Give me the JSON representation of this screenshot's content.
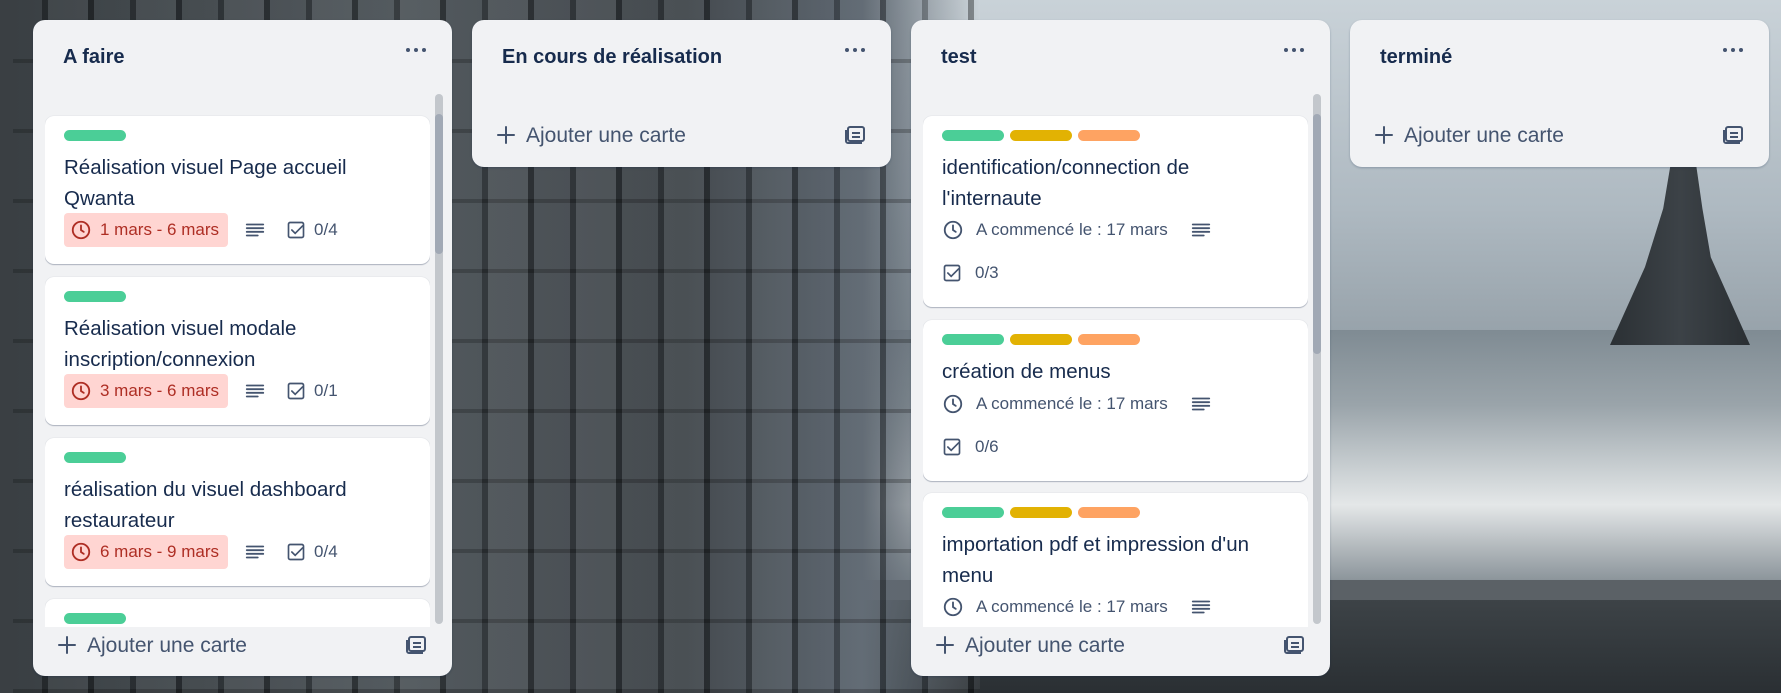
{
  "board": {
    "lists": [
      {
        "title": "A faire",
        "add_card_label": "Ajouter une carte",
        "cards": [
          {
            "labels": [
              "#4bce97"
            ],
            "title": "Réalisation visuel Page accueil Qwanta",
            "due": "1 mars - 6 mars",
            "checklist": "0/4"
          },
          {
            "labels": [
              "#4bce97"
            ],
            "title": "Réalisation visuel modale inscription/connexion",
            "due": "3 mars - 6 mars",
            "checklist": "0/1"
          },
          {
            "labels": [
              "#4bce97"
            ],
            "title": "réalisation du visuel dashboard restaurateur",
            "due": "6 mars - 9 mars",
            "checklist": "0/4"
          },
          {
            "labels": [
              "#4bce97"
            ]
          }
        ]
      },
      {
        "title": "En cours de réalisation",
        "add_card_label": "Ajouter une carte",
        "cards": []
      },
      {
        "title": "test",
        "add_card_label": "Ajouter une carte",
        "cards": [
          {
            "labels": [
              "#4bce97",
              "#e2b203",
              "#fea362"
            ],
            "title": "identification/connection de l'internaute",
            "start": "A commencé le : 17 mars",
            "checklist": "0/3"
          },
          {
            "labels": [
              "#4bce97",
              "#e2b203",
              "#fea362"
            ],
            "title": "création de menus",
            "start": "A commencé le : 17 mars",
            "checklist": "0/6"
          },
          {
            "labels": [
              "#4bce97",
              "#e2b203",
              "#fea362"
            ],
            "title": "importation pdf et impression d'un menu",
            "start": "A commencé le : 17 mars"
          }
        ]
      },
      {
        "title": "terminé",
        "add_card_label": "Ajouter une carte",
        "cards": []
      }
    ]
  },
  "colors": {
    "list_bg": "#f1f2f4",
    "text": "#172b4d",
    "muted": "#44546f",
    "due_bg": "#ffd5d2",
    "due_text": "#ae2e24"
  },
  "icons": {
    "list_menu": "ellipsis-icon",
    "due": "clock-icon",
    "description": "description-icon",
    "checklist": "checklist-icon",
    "add": "plus-icon",
    "template": "card-template-icon"
  }
}
